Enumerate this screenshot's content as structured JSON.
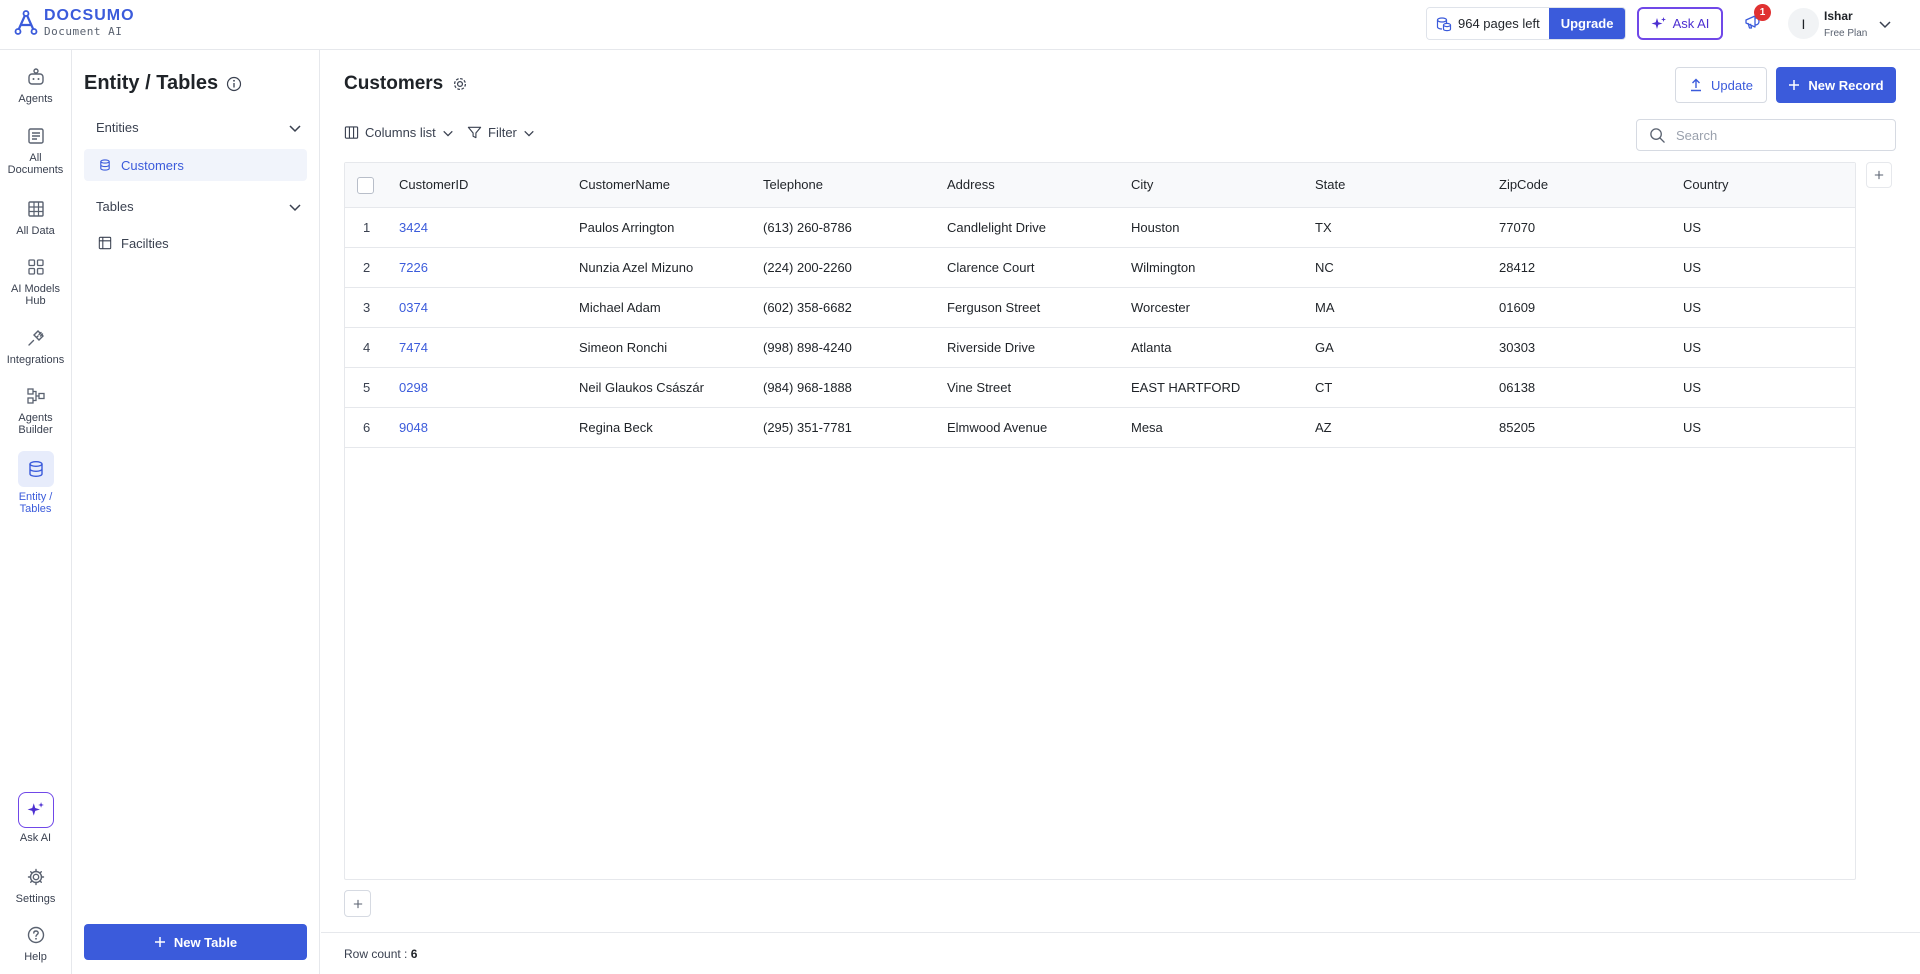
{
  "brand": {
    "name": "DOCSUMO",
    "subtitle": "Document AI"
  },
  "header": {
    "pages_left": "964 pages left",
    "upgrade_label": "Upgrade",
    "ask_ai_label": "Ask AI",
    "notification_count": "1",
    "user_initial": "I",
    "user_name": "Ishar",
    "user_plan": "Free Plan"
  },
  "rail": {
    "items": [
      {
        "label": "Agents",
        "icon": "agents-icon"
      },
      {
        "label": "All Documents",
        "icon": "documents-icon"
      },
      {
        "label": "All Data",
        "icon": "table-grid-icon"
      },
      {
        "label": "AI Models Hub",
        "icon": "models-grid-icon"
      },
      {
        "label": "Integrations",
        "icon": "plug-icon"
      },
      {
        "label": "Agents Builder",
        "icon": "builder-icon"
      },
      {
        "label": "Entity / Tables",
        "icon": "database-icon",
        "active": true
      }
    ],
    "bottom": [
      {
        "label": "Ask AI",
        "icon": "sparkle-icon"
      },
      {
        "label": "Settings",
        "icon": "gear-icon"
      },
      {
        "label": "Help",
        "icon": "help-icon"
      }
    ]
  },
  "panel": {
    "title": "Entity / Tables",
    "entities_heading": "Entities",
    "entities": [
      "Customers"
    ],
    "tables_heading": "Tables",
    "tables": [
      "Facilties"
    ],
    "new_table_label": "New Table"
  },
  "main": {
    "title": "Customers",
    "update_label": "Update",
    "new_record_label": "New Record",
    "columns_label": "Columns list",
    "filter_label": "Filter",
    "search_placeholder": "Search",
    "row_count_label": "Row count :",
    "row_count": "6"
  },
  "table": {
    "columns": [
      "CustomerID",
      "CustomerName",
      "Telephone",
      "Address",
      "City",
      "State",
      "ZipCode",
      "Country"
    ],
    "rows": [
      {
        "idx": "1",
        "CustomerID": "3424",
        "CustomerName": "Paulos Arrington",
        "Telephone": "(613) 260-8786",
        "Address": "Candlelight Drive",
        "City": "Houston",
        "State": "TX",
        "ZipCode": "77070",
        "Country": "US"
      },
      {
        "idx": "2",
        "CustomerID": "7226",
        "CustomerName": "Nunzia Azel Mizuno",
        "Telephone": "(224) 200-2260",
        "Address": "Clarence Court",
        "City": "Wilmington",
        "State": "NC",
        "ZipCode": "28412",
        "Country": "US"
      },
      {
        "idx": "3",
        "CustomerID": "0374",
        "CustomerName": "Michael Adam",
        "Telephone": "(602) 358-6682",
        "Address": "Ferguson Street",
        "City": "Worcester",
        "State": "MA",
        "ZipCode": "01609",
        "Country": "US"
      },
      {
        "idx": "4",
        "CustomerID": "7474",
        "CustomerName": "Simeon Ronchi",
        "Telephone": "(998) 898-4240",
        "Address": "Riverside Drive",
        "City": "Atlanta",
        "State": "GA",
        "ZipCode": "30303",
        "Country": "US"
      },
      {
        "idx": "5",
        "CustomerID": "0298",
        "CustomerName": "Neil Glaukos Császár",
        "Telephone": "(984) 968-1888",
        "Address": "Vine Street",
        "City": "EAST HARTFORD",
        "State": "CT",
        "ZipCode": "06138",
        "Country": "US"
      },
      {
        "idx": "6",
        "CustomerID": "9048",
        "CustomerName": "Regina Beck",
        "Telephone": "(295) 351-7781",
        "Address": "Elmwood Avenue",
        "City": "Mesa",
        "State": "AZ",
        "ZipCode": "85205",
        "Country": "US"
      }
    ]
  },
  "colors": {
    "accent": "#3b5bdb",
    "ask_ai": "#7048e8",
    "badge": "#e03131"
  }
}
